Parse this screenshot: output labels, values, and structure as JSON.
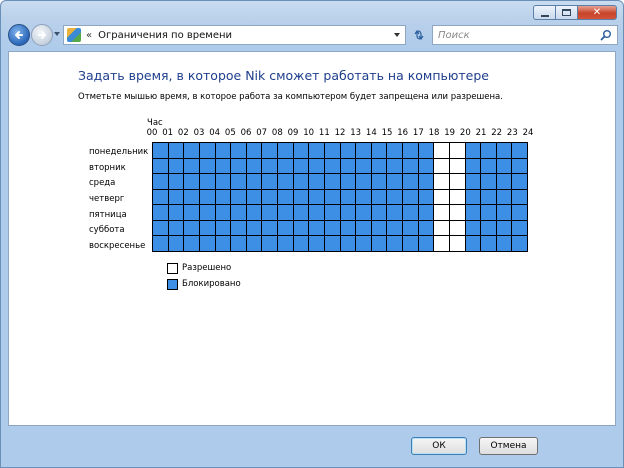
{
  "window": {
    "title": "Ограничения по времени"
  },
  "navbar": {
    "address_chevron": "«",
    "address_text": "Ограничения по времени",
    "search_placeholder": "Поиск"
  },
  "content": {
    "title": "Задать время, в которое Nik сможет работать на компьютере",
    "instruction": "Отметьте мышью время, в которое работа за компьютером будет запрещена или разрешена.",
    "hour_label": "Час",
    "hours": [
      "00",
      "01",
      "02",
      "03",
      "04",
      "05",
      "06",
      "07",
      "08",
      "09",
      "10",
      "11",
      "12",
      "13",
      "14",
      "15",
      "16",
      "17",
      "18",
      "19",
      "20",
      "21",
      "22",
      "23",
      "24"
    ],
    "days": [
      "понедельник",
      "вторник",
      "среда",
      "четверг",
      "пятница",
      "суббота",
      "воскресенье"
    ],
    "allowed_hours": [
      18,
      19
    ],
    "colors": {
      "blocked": "#3d8fe6",
      "allowed": "#ffffff"
    }
  },
  "legend": {
    "allowed_label": "Разрешено",
    "blocked_label": "Блокировано"
  },
  "footer": {
    "ok_label": "ОК",
    "cancel_label": "Отмена"
  }
}
